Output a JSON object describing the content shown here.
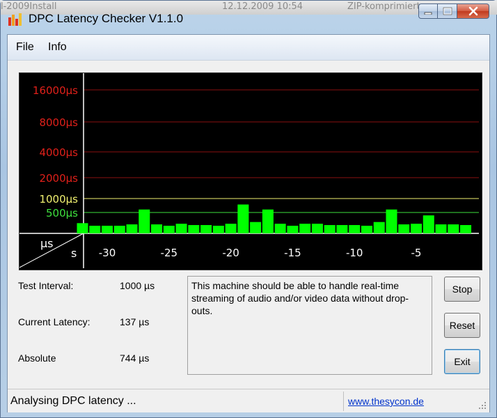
{
  "background": {
    "fragments": [
      "l-2009Install",
      "12.12.2009 10:54",
      "ZIP-komprimierter"
    ]
  },
  "window": {
    "title": "DPC Latency Checker V1.1.0",
    "icon": "bar-chart-icon"
  },
  "menu": [
    "File",
    "Info"
  ],
  "chart_data": {
    "type": "bar",
    "y_labels": [
      {
        "text": "16000µs",
        "color": "#e0201a"
      },
      {
        "text": "8000µs",
        "color": "#e0201a"
      },
      {
        "text": "4000µs",
        "color": "#e0201a"
      },
      {
        "text": "2000µs",
        "color": "#e0201a"
      },
      {
        "text": "1000µs",
        "color": "#f0f070"
      },
      {
        "text": "500µs",
        "color": "#3ee03e"
      }
    ],
    "x_ticks": [
      "-30",
      "-25",
      "-20",
      "-15",
      "-10",
      "-5"
    ],
    "x_tick_seconds": [
      -30,
      -25,
      -20,
      -15,
      -10,
      -5
    ],
    "corner_y_unit": "µs",
    "corner_x_unit": "s",
    "seconds": [
      -32,
      -31,
      -30,
      -29,
      -28,
      -27,
      -26,
      -25,
      -24,
      -23,
      -22,
      -21,
      -20,
      -19,
      -18,
      -17,
      -16,
      -15,
      -14,
      -13,
      -12,
      -11,
      -10,
      -9,
      -8,
      -7,
      -6,
      -5,
      -4,
      -3,
      -2,
      -1
    ],
    "values_us": [
      220,
      180,
      180,
      180,
      200,
      580,
      200,
      180,
      210,
      190,
      190,
      180,
      210,
      744,
      240,
      580,
      210,
      180,
      210,
      210,
      190,
      190,
      190,
      180,
      240,
      580,
      200,
      210,
      400,
      200,
      200,
      190
    ],
    "bar_color": "#00ff00",
    "grid_colors": {
      "red": "#8a1010",
      "yellow": "#f0f070",
      "green": "#3ee03e"
    }
  },
  "info": {
    "test_interval": {
      "label": "Test Interval:",
      "value": "1000 µs"
    },
    "current_latency": {
      "label": "Current Latency:",
      "value": "137 µs"
    },
    "absolute": {
      "label": "Absolute",
      "value": "744 µs"
    }
  },
  "message": "This machine should be able to handle real-time streaming of audio and/or video data without drop-outs.",
  "buttons": {
    "stop": "Stop",
    "reset": "Reset",
    "exit": "Exit"
  },
  "status": {
    "text": "Analysing DPC latency ...",
    "link": "www.thesycon.de"
  }
}
